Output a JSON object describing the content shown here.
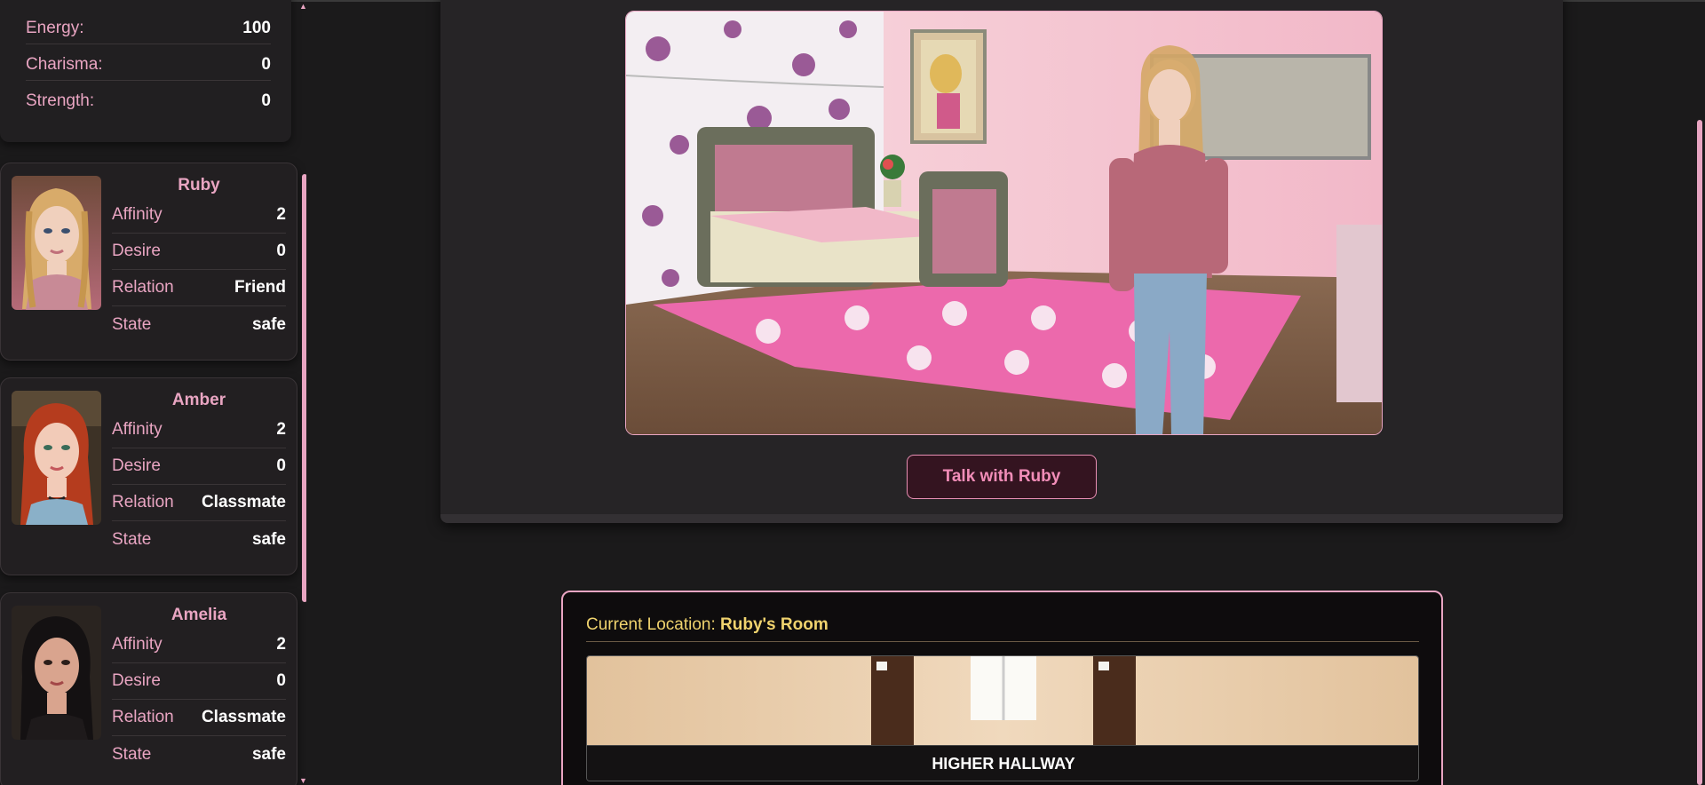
{
  "player_stats": [
    {
      "label": "Energy:",
      "value": "100"
    },
    {
      "label": "Charisma:",
      "value": "0"
    },
    {
      "label": "Strength:",
      "value": "0"
    }
  ],
  "characters": [
    {
      "name": "Ruby",
      "stats": [
        {
          "label": "Affinity",
          "value": "2"
        },
        {
          "label": "Desire",
          "value": "0"
        },
        {
          "label": "Relation",
          "value": "Friend"
        },
        {
          "label": "State",
          "value": "safe"
        }
      ]
    },
    {
      "name": "Amber",
      "stats": [
        {
          "label": "Affinity",
          "value": "2"
        },
        {
          "label": "Desire",
          "value": "0"
        },
        {
          "label": "Relation",
          "value": "Classmate"
        },
        {
          "label": "State",
          "value": "safe"
        }
      ]
    },
    {
      "name": "Amelia",
      "stats": [
        {
          "label": "Affinity",
          "value": "2"
        },
        {
          "label": "Desire",
          "value": "0"
        },
        {
          "label": "Relation",
          "value": "Classmate"
        },
        {
          "label": "State",
          "value": "safe"
        }
      ]
    }
  ],
  "scene": {
    "talk_button": "Talk with Ruby"
  },
  "location": {
    "label": "Current Location:",
    "value": "Ruby's Room",
    "destinations": [
      {
        "name": "HIGHER HALLWAY"
      }
    ]
  },
  "colors": {
    "accent_pink": "#e9a5c2",
    "gold": "#f0d36e",
    "background": "#1b1a1b"
  }
}
